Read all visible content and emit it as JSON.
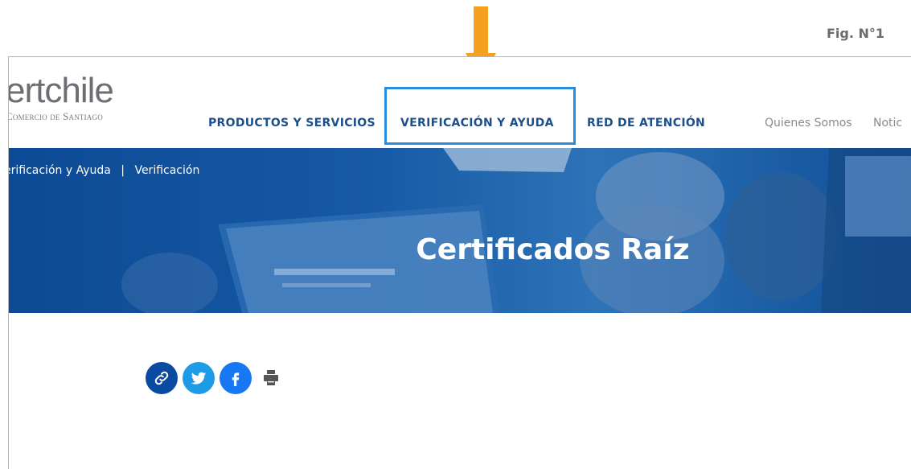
{
  "figure_label": "Fig. N°1",
  "logo": {
    "main": "ertchile",
    "sub": "Comercio de Santiago"
  },
  "nav": {
    "products": "PRODUCTOS Y SERVICIOS",
    "verification": "VERIFICACIÓN Y AYUDA",
    "network": "RED DE ATENCIÓN",
    "about": "Quienes Somos",
    "news": "Notic"
  },
  "breadcrumb": {
    "first": "erificación y Ayuda",
    "separator": "|",
    "current": "Verificación"
  },
  "hero": {
    "title": "Certificados Raíz"
  },
  "share": {
    "icons": [
      "link-icon",
      "twitter-icon",
      "facebook-icon",
      "print-icon"
    ]
  },
  "colors": {
    "nav": "#1d4f8a",
    "highlight": "#2a8ddb",
    "arrow": "#f5a01e",
    "hero": "#1659a5"
  }
}
